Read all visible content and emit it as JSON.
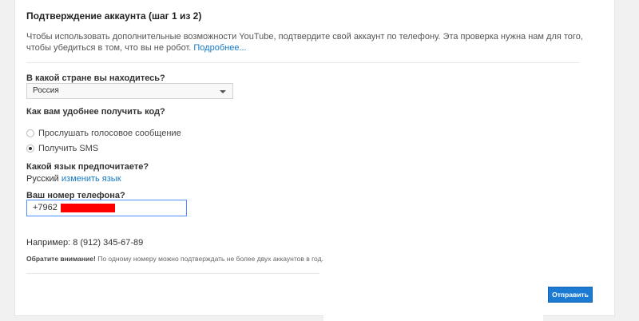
{
  "form": {
    "title": "Подтверждение аккаунта (шаг 1 из 2)",
    "intro_text": "Чтобы использовать дополнительные возможности YouTube, подтвердите свой аккаунт по телефону. Эта проверка нужна нам для того, чтобы убедиться в том, что вы не робот.",
    "learn_more_link": "Подробнее...",
    "country_question": "В какой стране вы находитесь?",
    "country_selected": "Россия",
    "method_question": "Как вам удобнее получить код?",
    "method_options": [
      {
        "label": "Прослушать голосовое сообщение",
        "checked": false
      },
      {
        "label": "Получить SMS",
        "checked": true
      }
    ],
    "language_question": "Какой язык предпочитаете?",
    "language_value": "Русский",
    "change_language_link": "изменить язык",
    "phone_question": "Ваш номер телефона?",
    "phone_value": "+7962",
    "example_text": "Например: 8 (912) 345-67-89",
    "note_label": "Обратите внимание!",
    "note_text": "По одному номеру можно подтверждать не более двух аккаунтов в год.",
    "submit_label": "Отправить"
  },
  "colors": {
    "link": "#167ac6",
    "submit_bg": "#1b7bd3",
    "redaction": "#ff0000",
    "focus_border": "#4d90fe"
  }
}
